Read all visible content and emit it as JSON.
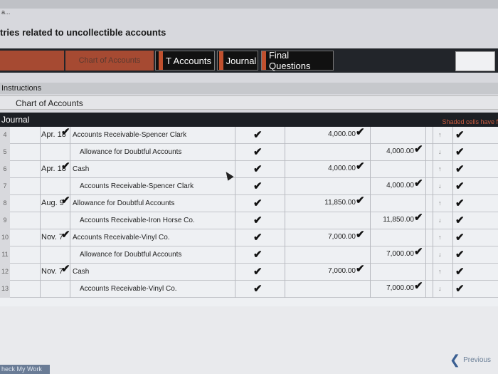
{
  "breadcrumb": "a...",
  "page_title": "tries related to uncollectible accounts",
  "tabs": [
    {
      "label": ""
    },
    {
      "label": "Chart of Accounts"
    },
    {
      "label": "T Accounts"
    },
    {
      "label": "Journal"
    },
    {
      "label": "Final Questions"
    }
  ],
  "instructions_label": "Instructions",
  "chart_of_accounts_label": "Chart of Accounts",
  "journal_label": "Journal",
  "shaded_note": "Shaded cells have f",
  "rows": [
    {
      "num": "4",
      "date": "Apr. 18",
      "account": "Accounts Receivable-Spencer Clark",
      "debit": "4,000.00",
      "credit": "",
      "indent": false
    },
    {
      "num": "5",
      "date": "",
      "account": "Allowance for Doubtful Accounts",
      "debit": "",
      "credit": "4,000.00",
      "indent": true
    },
    {
      "num": "6",
      "date": "Apr. 18",
      "account": "Cash",
      "debit": "4,000.00",
      "credit": "",
      "indent": false
    },
    {
      "num": "7",
      "date": "",
      "account": "Accounts Receivable-Spencer Clark",
      "debit": "",
      "credit": "4,000.00",
      "indent": true
    },
    {
      "num": "8",
      "date": "Aug. 9",
      "account": "Allowance for Doubtful Accounts",
      "debit": "11,850.00",
      "credit": "",
      "indent": false
    },
    {
      "num": "9",
      "date": "",
      "account": "Accounts Receivable-Iron Horse Co.",
      "debit": "",
      "credit": "11,850.00",
      "indent": true
    },
    {
      "num": "10",
      "date": "Nov. 7",
      "account": "Accounts Receivable-Vinyl Co.",
      "debit": "7,000.00",
      "credit": "",
      "indent": false
    },
    {
      "num": "11",
      "date": "",
      "account": "Allowance for Doubtful Accounts",
      "debit": "",
      "credit": "7,000.00",
      "indent": true
    },
    {
      "num": "12",
      "date": "Nov. 7",
      "account": "Cash",
      "debit": "7,000.00",
      "credit": "",
      "indent": false
    },
    {
      "num": "13",
      "date": "",
      "account": "Accounts Receivable-Vinyl Co.",
      "debit": "",
      "credit": "7,000.00",
      "indent": true
    }
  ],
  "check_mark": "✔",
  "previous_label": "Previous",
  "check_work_label": "heck My Work"
}
